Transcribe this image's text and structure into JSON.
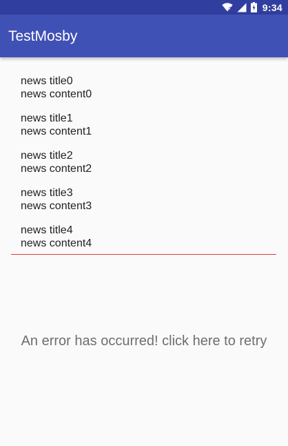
{
  "status_bar": {
    "time": "9:34",
    "icons": [
      "wifi-icon",
      "signal-icon",
      "battery-icon"
    ],
    "background": "#303f9f"
  },
  "app_bar": {
    "title": "TestMosby",
    "background": "#3f51b5"
  },
  "news": [
    {
      "title": "news title0",
      "content": "news content0"
    },
    {
      "title": "news title1",
      "content": "news content1"
    },
    {
      "title": "news title2",
      "content": "news content2"
    },
    {
      "title": "news title3",
      "content": "news content3"
    },
    {
      "title": "news title4",
      "content": "news content4"
    }
  ],
  "divider_color": "#e53935",
  "error": {
    "message": "An error has occurred! click here to retry"
  }
}
